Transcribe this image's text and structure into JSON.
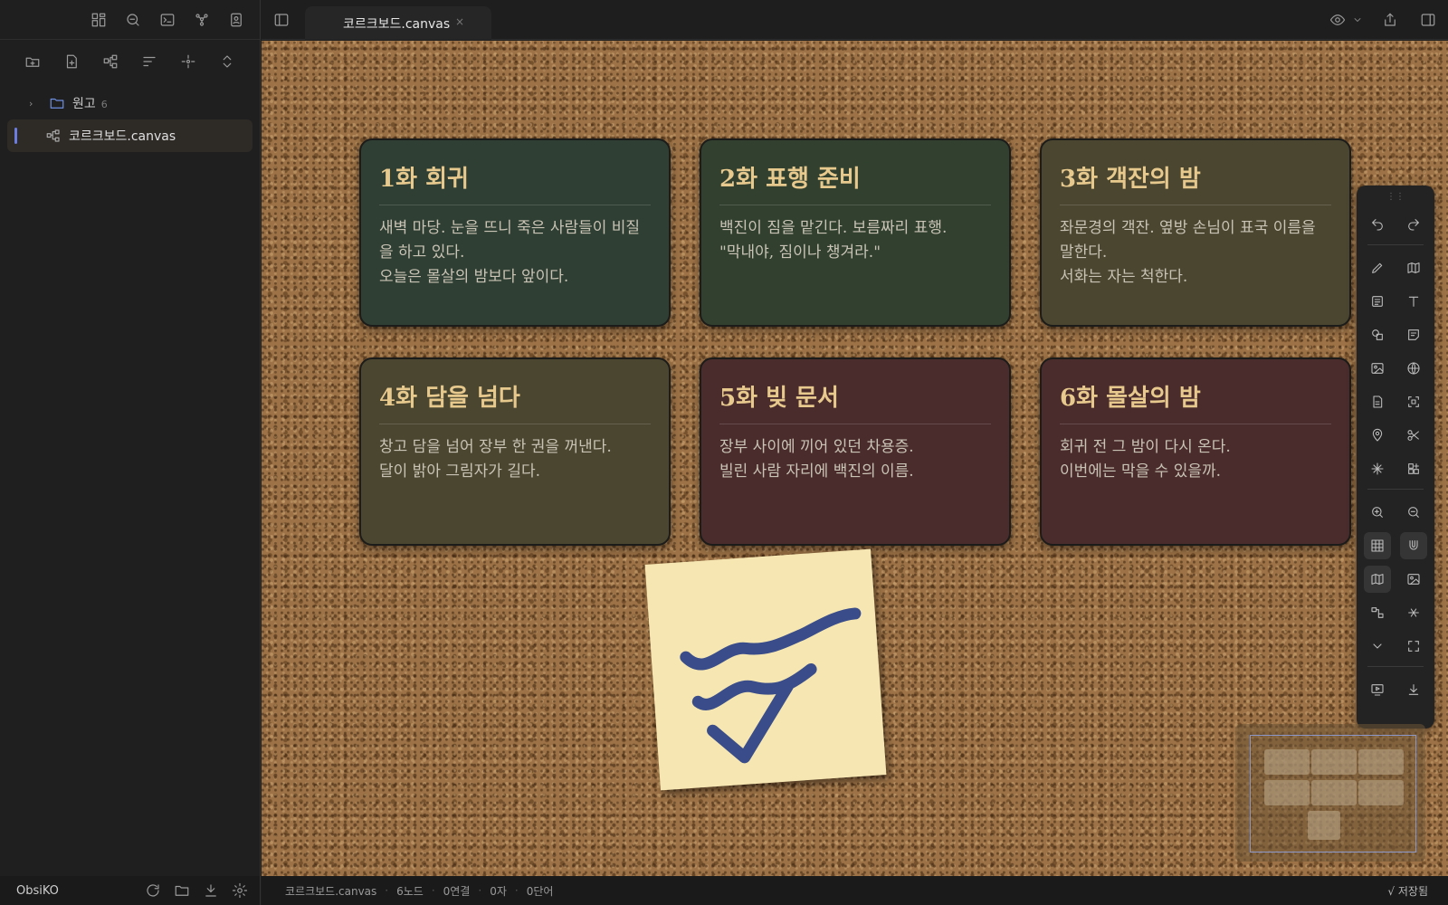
{
  "app": {
    "name": "ObsiKO"
  },
  "tab": {
    "title": "코르크보드.canvas",
    "close": "×"
  },
  "file_tree": {
    "folder": {
      "name": "원고",
      "count": "6",
      "chevron": "›"
    },
    "file": {
      "name": "코르크보드.canvas"
    }
  },
  "cards": [
    {
      "title": "1화 회귀",
      "body": "새벽 마당. 눈을 뜨니 죽은 사람들이 비질을 하고 있다.\n오늘은 몰살의 밤보다 앞이다.",
      "color": "#2f3f33"
    },
    {
      "title": "2화 표행 준비",
      "body": "백진이 짐을 맡긴다. 보름짜리 표행.\n\"막내야, 짐이나 챙겨라.\"",
      "color": "#31402f"
    },
    {
      "title": "3화 객잔의 밤",
      "body": "좌문경의 객잔. 옆방 손님이 표국 이름을 말한다.\n서화는 자는 척한다.",
      "color": "#4a4630"
    },
    {
      "title": "4화 담을 넘다",
      "body": "창고 담을 넘어 장부 한 권을 꺼낸다.\n달이 밝아 그림자가 길다.",
      "color": "#4a4630"
    },
    {
      "title": "5화 빚 문서",
      "body": "장부 사이에 끼어 있던 차용증.\n빌린 사람 자리에 백진의 이름.",
      "color": "#4a2c2c"
    },
    {
      "title": "6화 몰살의 밤",
      "body": "회귀 전 그 밤이 다시 온다.\n이번에는 막을 수 있을까.",
      "color": "#4a2c2c"
    }
  ],
  "status": {
    "file": "코르크보드.canvas",
    "nodes": "6노드",
    "links": "0연결",
    "chars": "0자",
    "words": "0단어",
    "saved": "√ 저장됨"
  },
  "colors": {
    "accent": "#6b7de0",
    "card_title": "#e7c98e",
    "sticky": "#f6e7b2",
    "ink": "#3a4d8a"
  }
}
